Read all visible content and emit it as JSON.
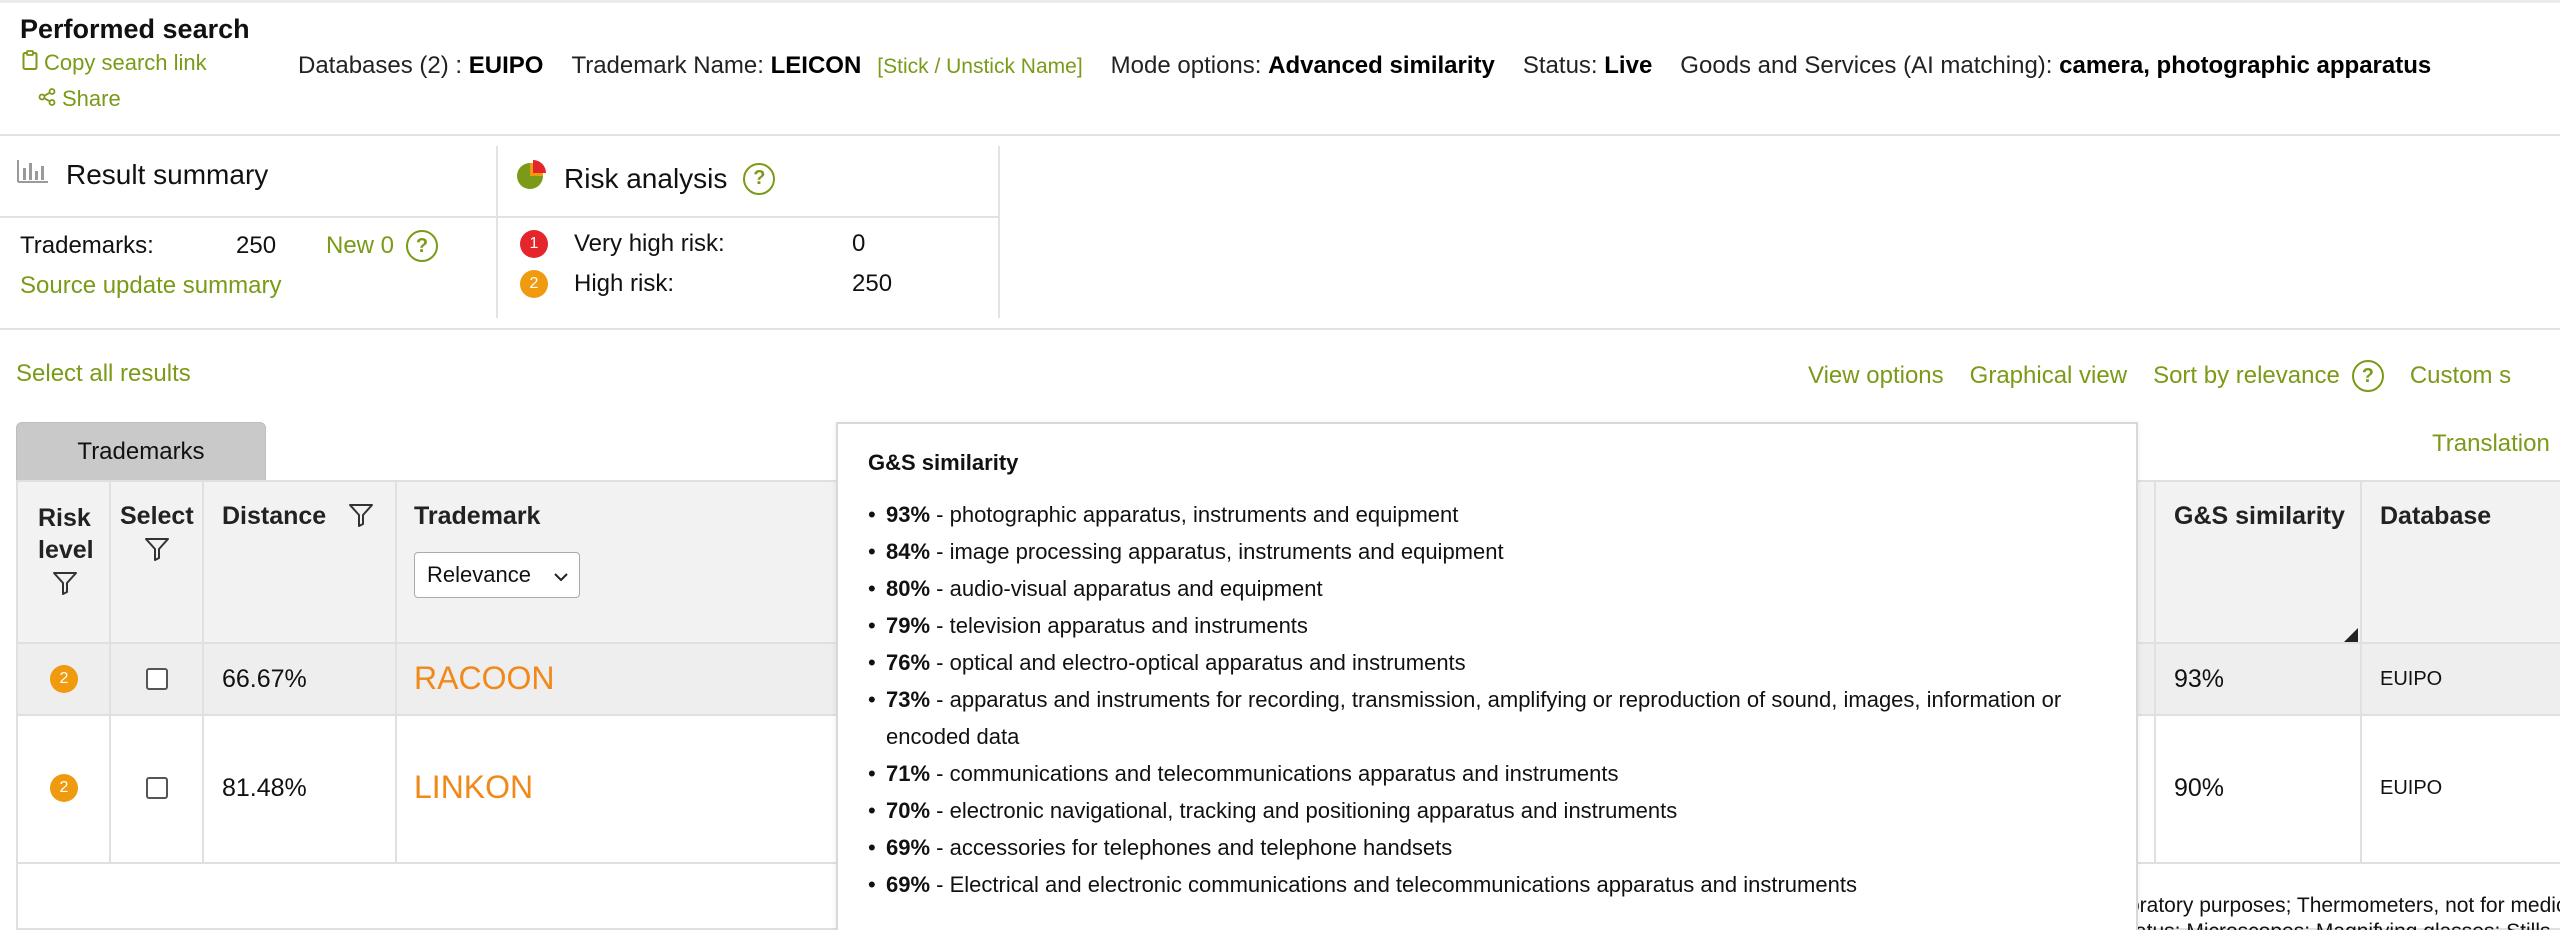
{
  "header": {
    "title": "Performed search",
    "copy_link": "Copy search link",
    "share": "Share",
    "databases_label": "Databases (2) :",
    "databases_value": "EUIPO",
    "trademark_label": "Trademark Name:",
    "trademark_value": "LEICON",
    "stick_link": "[Stick / Unstick Name]",
    "mode_label": "Mode options:",
    "mode_value": "Advanced similarity",
    "status_label": "Status:",
    "status_value": "Live",
    "gs_label": "Goods and Services (AI matching):",
    "gs_value": "camera, photographic apparatus"
  },
  "result_summary": {
    "title": "Result summary",
    "trademarks_label": "Trademarks:",
    "trademarks_value": "250",
    "new_label": "New 0",
    "source_update": "Source update summary"
  },
  "risk_analysis": {
    "title": "Risk analysis",
    "rows": [
      {
        "badge": "1",
        "label": "Very high risk:",
        "value": "0"
      },
      {
        "badge": "2",
        "label": "High risk:",
        "value": "250"
      }
    ]
  },
  "actions": {
    "select_all": "Select all results",
    "view_options": "View options",
    "graphical_view": "Graphical view",
    "sort_by": "Sort by relevance",
    "custom": "Custom s"
  },
  "tabs": {
    "trademarks": "Trademarks",
    "translation": "Translation"
  },
  "table": {
    "headers": {
      "risk_level": "Risk level",
      "select": "Select",
      "distance": "Distance",
      "trademark": "Trademark",
      "gs_similarity": "G&S similarity",
      "database": "Database"
    },
    "sort_select": "Relevance",
    "rows": [
      {
        "risk": "2",
        "distance": "66.67%",
        "trademark": "RACOON",
        "gs": "93%",
        "database": "EUIPO"
      },
      {
        "risk": "2",
        "distance": "81.48%",
        "trademark": "LINKON",
        "gs": "90%",
        "database": "EUIPO"
      }
    ],
    "side_text_1": "oratory purposes; Thermometers, not for medic",
    "side_text_2": "ratus; Microscopes; Magnifying glasses; Stills"
  },
  "tooltip": {
    "title": "G&S similarity",
    "items": [
      {
        "pct": "93%",
        "text": " - photographic apparatus, instruments and equipment"
      },
      {
        "pct": "84%",
        "text": " - image processing apparatus, instruments and equipment"
      },
      {
        "pct": "80%",
        "text": " - audio-visual apparatus and equipment"
      },
      {
        "pct": "79%",
        "text": " - television apparatus and instruments"
      },
      {
        "pct": "76%",
        "text": " - optical and electro-optical apparatus and instruments"
      },
      {
        "pct": "73%",
        "text": " - apparatus and instruments for recording, transmission, amplifying or reproduction of sound, images, information or encoded data"
      },
      {
        "pct": "71%",
        "text": " - communications and telecommunications apparatus and instruments"
      },
      {
        "pct": "70%",
        "text": " - electronic navigational, tracking and positioning apparatus and instruments"
      },
      {
        "pct": "69%",
        "text": " - accessories for telephones and telephone handsets"
      },
      {
        "pct": "69%",
        "text": " - Electrical and electronic communications and telecommunications apparatus and instruments"
      }
    ]
  },
  "colors": {
    "accent_green": "#7a9a18",
    "trademark_orange": "#f0891a",
    "risk_red": "#e4252b",
    "risk_orange": "#f09a10"
  },
  "icons": [
    "clipboard-icon",
    "share-icon",
    "bar-chart-icon",
    "pie-chart-icon",
    "help-icon",
    "filter-icon",
    "chevron-down-icon"
  ]
}
